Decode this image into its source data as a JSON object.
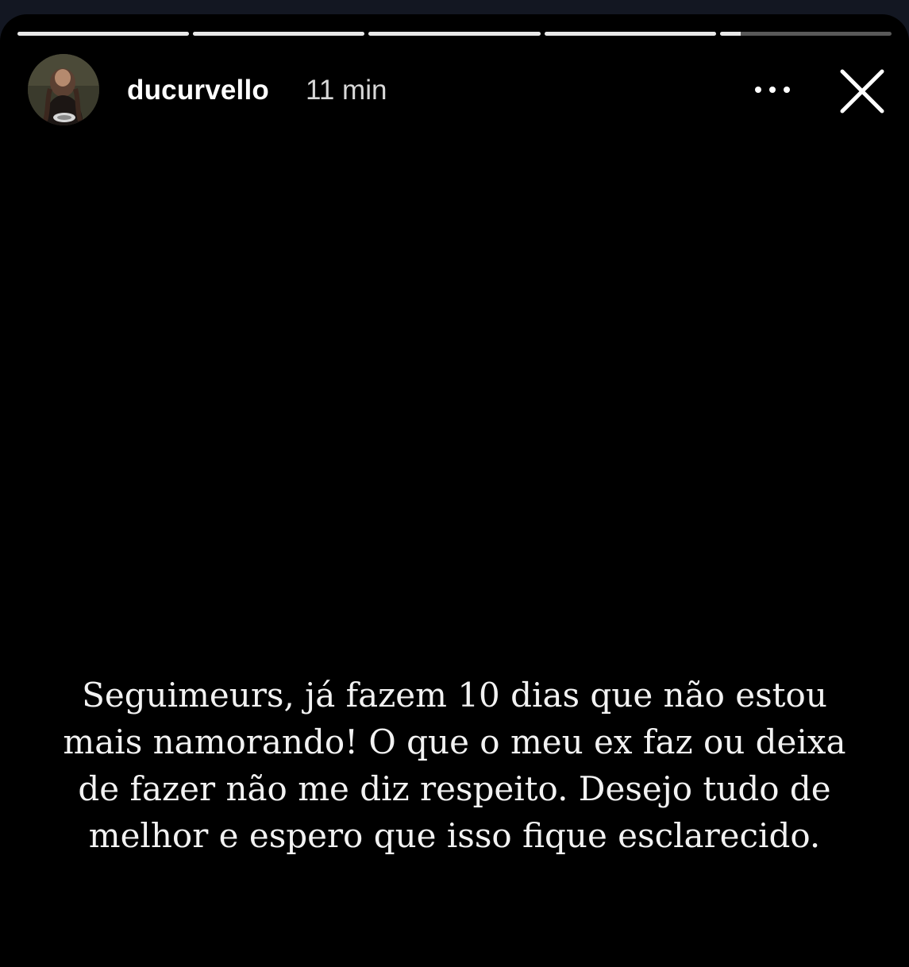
{
  "story": {
    "progress_segments": [
      1,
      1,
      1,
      1,
      0.12
    ],
    "user": {
      "username": "ducurvello",
      "time_ago": "11 min"
    },
    "icons": {
      "more": "more-horizontal-icon",
      "close": "close-icon"
    },
    "caption": "Seguimeurs, já fazem 10 dias que não estou\nmais namorando! O que o meu ex faz ou deixa\nde fazer não me diz respeito. Desejo tudo de\nmelhor e espero que isso fique esclarecido.",
    "colors": {
      "background": "#000000",
      "text": "#ffffff",
      "progress_track": "#5a5a5a",
      "progress_fill": "#e9e9e9"
    }
  }
}
